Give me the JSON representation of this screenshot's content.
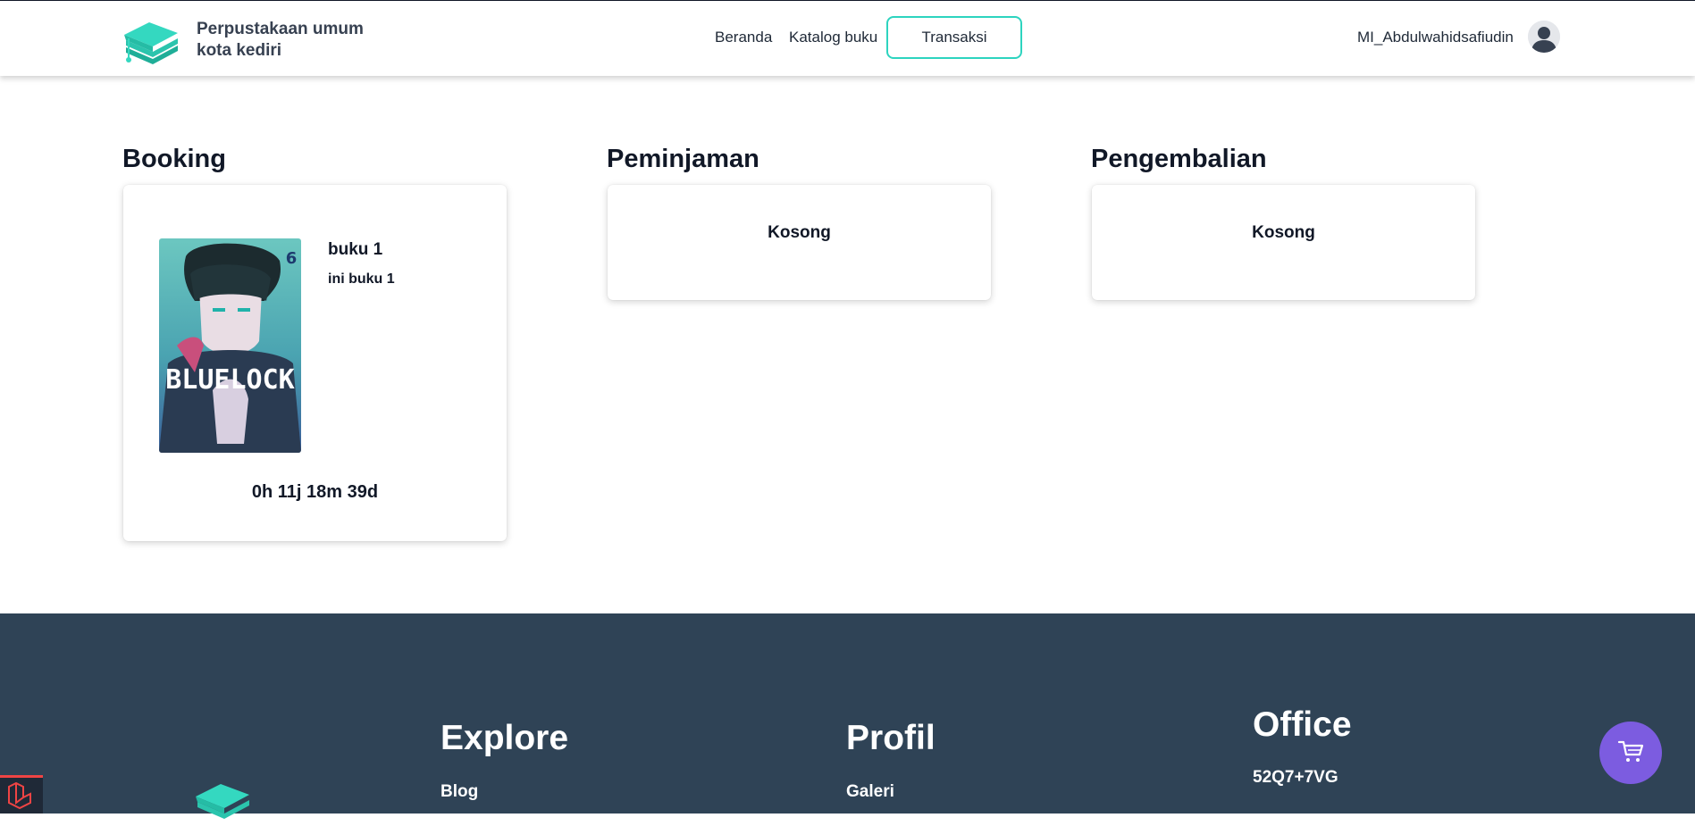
{
  "header": {
    "brand_line1": "Perpustakaan umum",
    "brand_line2": "kota kediri",
    "nav": [
      "Beranda",
      "Katalog buku",
      "Transaksi"
    ],
    "active_nav": "Transaksi",
    "user_name": "MI_Abdulwahidsafiudin"
  },
  "sections": {
    "booking": {
      "title": "Booking",
      "book_title": "buku 1",
      "book_desc": "ini buku 1",
      "cover_text": "BLUELOCK",
      "cover_volume": "6",
      "countdown": "0h 11j 18m 39d"
    },
    "peminjaman": {
      "title": "Peminjaman",
      "empty": "Kosong"
    },
    "pengembalian": {
      "title": "Pengembalian",
      "empty": "Kosong"
    }
  },
  "footer": {
    "explore": {
      "heading": "Explore",
      "first_link": "Blog"
    },
    "profil": {
      "heading": "Profil",
      "first_link": "Galeri"
    },
    "office": {
      "heading": "Office",
      "code": "52Q7+7VG"
    }
  },
  "colors": {
    "accent": "#2dd4bf",
    "footer_bg": "#2f4356",
    "cart_button": "#7c5ce0"
  },
  "icons": [
    "graduation-cap-books-logo",
    "user-avatar-icon",
    "cart-icon",
    "laravel-icon"
  ]
}
